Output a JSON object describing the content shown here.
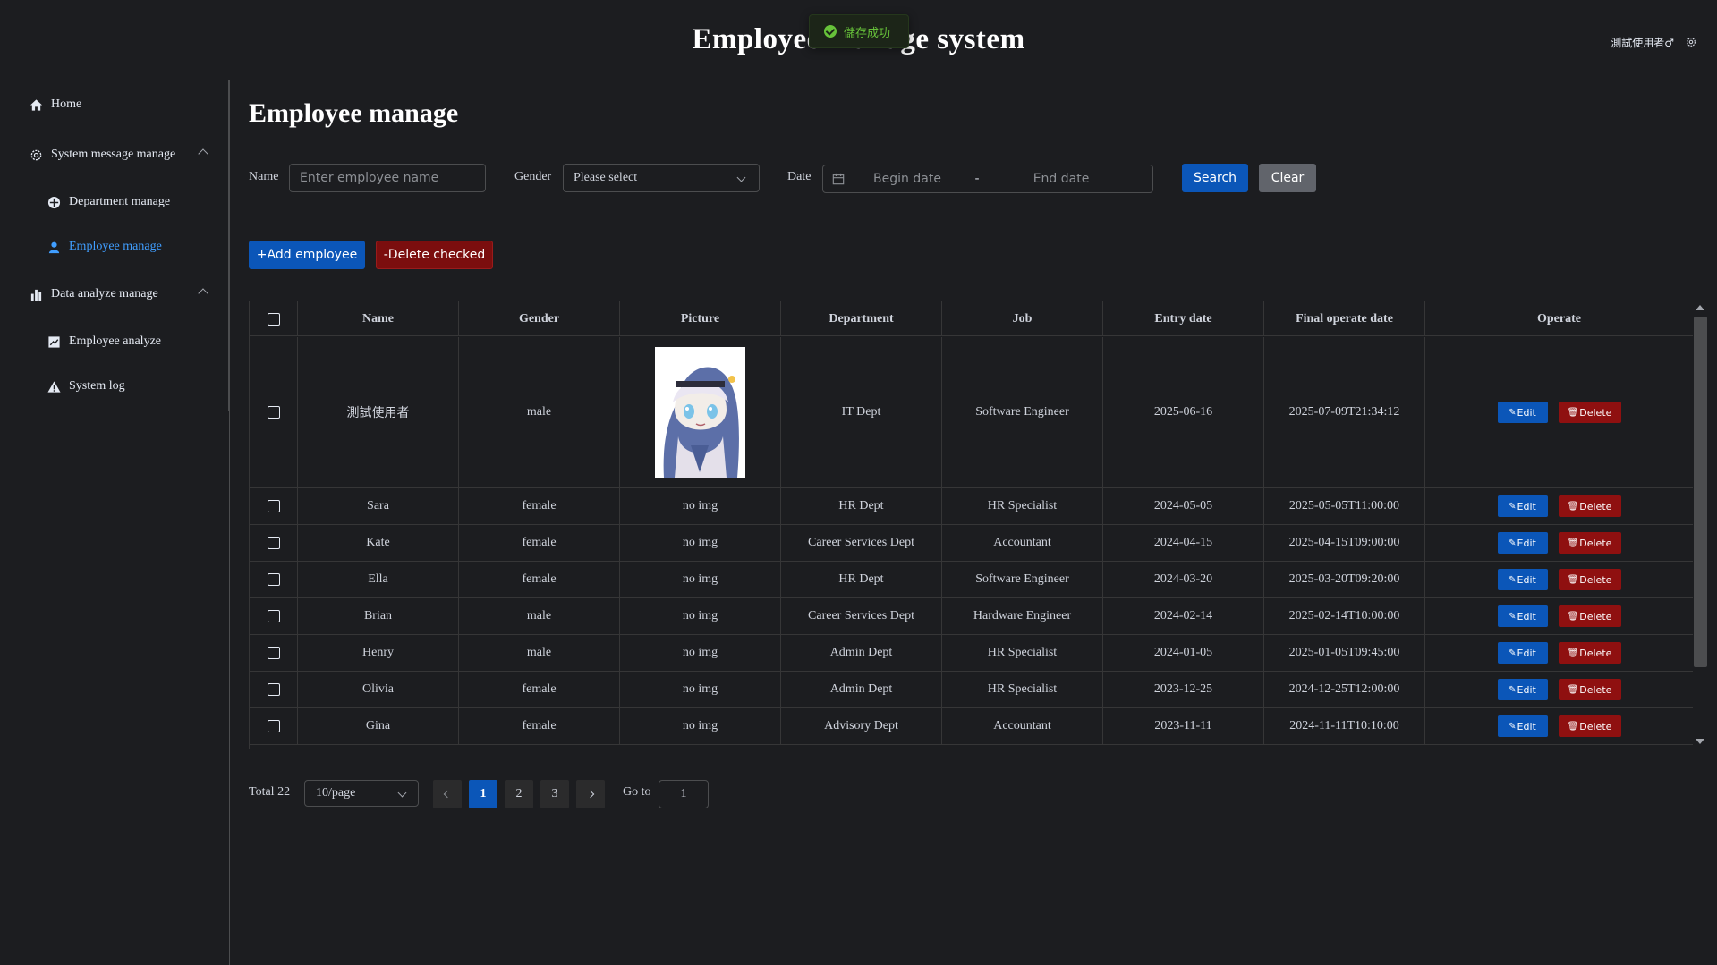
{
  "header": {
    "title": "Employee manage system",
    "user": "測試使用者♂",
    "settings_icon": "gear-icon"
  },
  "toast": {
    "message": "儲存成功",
    "icon": "check-circle-icon",
    "color": "#67c23a"
  },
  "sidebar": {
    "items": [
      {
        "label": "Home",
        "icon": "home-icon"
      },
      {
        "label": "System message manage",
        "icon": "gear-icon",
        "expanded": true
      },
      {
        "label": "Department manage",
        "icon": "department-icon"
      },
      {
        "label": "Employee manage",
        "icon": "user-icon",
        "active": true
      },
      {
        "label": "Data analyze manage",
        "icon": "bar-chart-icon",
        "expanded": true
      },
      {
        "label": "Employee analyze",
        "icon": "trend-chart-icon"
      },
      {
        "label": "System log",
        "icon": "warning-icon"
      }
    ]
  },
  "main": {
    "title": "Employee manage",
    "filters": {
      "name_label": "Name",
      "name_placeholder": "Enter employee name",
      "gender_label": "Gender",
      "gender_value": "Please select",
      "date_label": "Date",
      "begin_placeholder": "Begin date",
      "date_separator": "-",
      "end_placeholder": "End date",
      "search_label": "Search",
      "clear_label": "Clear"
    },
    "actions": {
      "add_label": "+Add employee",
      "delete_checked_label": "-Delete checked"
    },
    "table": {
      "columns": [
        "Name",
        "Gender",
        "Picture",
        "Department",
        "Job",
        "Entry date",
        "Final operate date",
        "Operate"
      ],
      "edit_label": "Edit",
      "delete_label": "Delete",
      "rows": [
        {
          "name": "測試使用者",
          "gender": "male",
          "picture": "",
          "department": "IT Dept",
          "job": "Software Engineer",
          "entry": "2025-06-16",
          "final": "2025-07-09T21:34:12"
        },
        {
          "name": "Sara",
          "gender": "female",
          "picture": "no img",
          "department": "HR Dept",
          "job": "HR Specialist",
          "entry": "2024-05-05",
          "final": "2025-05-05T11:00:00"
        },
        {
          "name": "Kate",
          "gender": "female",
          "picture": "no img",
          "department": "Career Services Dept",
          "job": "Accountant",
          "entry": "2024-04-15",
          "final": "2025-04-15T09:00:00"
        },
        {
          "name": "Ella",
          "gender": "female",
          "picture": "no img",
          "department": "HR Dept",
          "job": "Software Engineer",
          "entry": "2024-03-20",
          "final": "2025-03-20T09:20:00"
        },
        {
          "name": "Brian",
          "gender": "male",
          "picture": "no img",
          "department": "Career Services Dept",
          "job": "Hardware Engineer",
          "entry": "2024-02-14",
          "final": "2025-02-14T10:00:00"
        },
        {
          "name": "Henry",
          "gender": "male",
          "picture": "no img",
          "department": "Admin Dept",
          "job": "HR Specialist",
          "entry": "2024-01-05",
          "final": "2025-01-05T09:45:00"
        },
        {
          "name": "Olivia",
          "gender": "female",
          "picture": "no img",
          "department": "Admin Dept",
          "job": "HR Specialist",
          "entry": "2023-12-25",
          "final": "2024-12-25T12:00:00"
        },
        {
          "name": "Gina",
          "gender": "female",
          "picture": "no img",
          "department": "Advisory Dept",
          "job": "Accountant",
          "entry": "2023-11-11",
          "final": "2024-11-11T10:10:00"
        }
      ]
    },
    "pagination": {
      "total": "Total 22",
      "page_size": "10/page",
      "pages": [
        "1",
        "2",
        "3"
      ],
      "current": "1",
      "goto_label": "Go to",
      "goto_value": "1"
    }
  }
}
